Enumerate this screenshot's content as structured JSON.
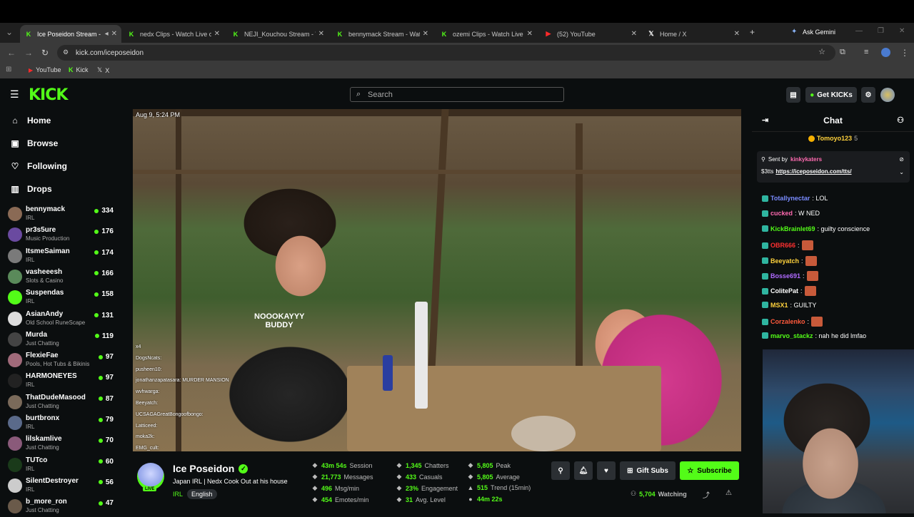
{
  "browser": {
    "tabs": [
      {
        "title": "Ice Poseidon Stream - V",
        "icon": "kick-icon",
        "active": true
      },
      {
        "title": "nedx Clips - Watch Live on",
        "icon": "kick-icon"
      },
      {
        "title": "NEJI_Kouchou Stream - Wa",
        "icon": "kick-icon"
      },
      {
        "title": "bennymack Stream - Watch",
        "icon": "kick-icon"
      },
      {
        "title": "ozemi Clips - Watch Live o",
        "icon": "kick-icon"
      },
      {
        "title": "(52) YouTube",
        "icon": "youtube-icon"
      },
      {
        "title": "Home / X",
        "icon": "x-icon"
      }
    ],
    "ask_gemini": "Ask Gemini",
    "url": "kick.com/iceposeidon",
    "bookmarks": [
      "YouTube",
      "Kick",
      "X"
    ]
  },
  "header": {
    "logo": "KICK",
    "search_placeholder": "Search",
    "get_kicks": "Get KICKs"
  },
  "sidebar": {
    "nav": [
      {
        "label": "Home",
        "icon": "home-icon"
      },
      {
        "label": "Browse",
        "icon": "browse-icon"
      },
      {
        "label": "Following",
        "icon": "heart-icon"
      },
      {
        "label": "Drops",
        "icon": "drops-icon"
      }
    ],
    "channels": [
      {
        "name": "bennymack",
        "category": "IRL",
        "viewers": "334",
        "color": "#8a6a55"
      },
      {
        "name": "pr3s5ure",
        "category": "Music Production",
        "viewers": "176",
        "color": "#6a4aa0"
      },
      {
        "name": "ItsmeSaiman",
        "category": "IRL",
        "viewers": "174",
        "color": "#7a7a7a"
      },
      {
        "name": "vasheeesh",
        "category": "Slots & Casino",
        "viewers": "166",
        "color": "#5a8a5a"
      },
      {
        "name": "Suspendas",
        "category": "IRL",
        "viewers": "158",
        "color": "#53fc18"
      },
      {
        "name": "AsianAndy",
        "category": "Old School RuneScape",
        "viewers": "131",
        "color": "#dddddd"
      },
      {
        "name": "Murda",
        "category": "Just Chatting",
        "viewers": "119",
        "color": "#444444"
      },
      {
        "name": "FlexieFae",
        "category": "Pools, Hot Tubs & Bikinis",
        "viewers": "97",
        "color": "#a06a7a"
      },
      {
        "name": "HARMONEYES",
        "category": "IRL",
        "viewers": "97",
        "color": "#222222"
      },
      {
        "name": "ThatDudeMasood",
        "category": "Just Chatting",
        "viewers": "87",
        "color": "#7a6a5a"
      },
      {
        "name": "burtbronx",
        "category": "IRL",
        "viewers": "79",
        "color": "#5a6a8a"
      },
      {
        "name": "lilskamlive",
        "category": "Just Chatting",
        "viewers": "70",
        "color": "#8a5a7a"
      },
      {
        "name": "TUTco",
        "category": "IRL",
        "viewers": "60",
        "color": "#1a3a1a"
      },
      {
        "name": "SilentDestroyer",
        "category": "IRL",
        "viewers": "56",
        "color": "#cccccc"
      },
      {
        "name": "b_more_ron",
        "category": "Just Chatting",
        "viewers": "47",
        "color": "#6a5a4a"
      }
    ]
  },
  "video": {
    "timestamp": "Aug 9, 5:24 PM",
    "shirt_text": "NOOOKAYYY BUDDY",
    "overlay_chat": [
      "x4",
      "DogsNcats:",
      "pusheen10:",
      "jonathanzapatasara: MURDER MANSION",
      "wvhwarga:",
      "Beeyatch:",
      "UCSAGAGreatBongoofbongo:",
      "Latticeed:",
      "moka2k:",
      "EMG_cult:"
    ]
  },
  "stream": {
    "name": "Ice Poseidon",
    "live_badge": "LIVE",
    "title": "Japan IRL | Nedx Cook Out at his house",
    "category": "IRL",
    "language": "English",
    "stats": [
      {
        "value": "43m 54s",
        "label": "Session",
        "icon": "clock-icon"
      },
      {
        "value": "21,773",
        "label": "Messages",
        "icon": "message-icon"
      },
      {
        "value": "496",
        "label": "Msg/min",
        "icon": "chart-icon"
      },
      {
        "value": "454",
        "label": "Emotes/min",
        "icon": "emote-icon"
      },
      {
        "value": "1,345",
        "label": "Chatters",
        "icon": "users-icon"
      },
      {
        "value": "433",
        "label": "Casuals",
        "icon": "users-icon"
      },
      {
        "value": "23%",
        "label": "Engagement",
        "icon": "engagement-icon"
      },
      {
        "value": "31",
        "label": "Avg. Level",
        "icon": "trophy-icon"
      },
      {
        "value": "5,805",
        "label": "Peak",
        "icon": "peak-icon"
      },
      {
        "value": "5,805",
        "label": "Average",
        "icon": "average-icon"
      },
      {
        "value": "515",
        "label": "Trend (15min)",
        "icon": "trend-up-icon"
      },
      {
        "value": "44m 22s",
        "label": "",
        "icon": "dot-icon"
      }
    ],
    "gift_subs": "Gift Subs",
    "subscribe": "Subscribe",
    "watching_count": "5,704",
    "watching_label": "Watching"
  },
  "chat": {
    "title": "Chat",
    "top_gifter": {
      "name": "Tomoyo123",
      "count": "5"
    },
    "pinned": {
      "sent_by_label": "Sent by",
      "sender": "kinkykaters",
      "text_prefix": "$3tts",
      "link": "https://iceposeidon.com/tts/"
    },
    "messages": [
      {
        "user": "Totallynectar",
        "text": ": LOL",
        "color": "#7a8cff"
      },
      {
        "user": "cucked",
        "text": ": W NED",
        "color": "#ff6ab0"
      },
      {
        "user": "KickBrainlet69",
        "text": ": guilty conscience",
        "color": "#53fc18"
      },
      {
        "user": "OBR666",
        "text": ":",
        "color": "#ff3030"
      },
      {
        "user": "Beeyatch",
        "text": ":",
        "color": "#ffd23c"
      },
      {
        "user": "Bosse691",
        "text": ":",
        "color": "#b06aff"
      },
      {
        "user": "ColitePat",
        "text": ":",
        "color": "#ffffff"
      },
      {
        "user": "MSX1",
        "text": ": GUILTY",
        "color": "#ffd23c"
      },
      {
        "user": "Corzalenko",
        "text": ":",
        "color": "#ff5a3c"
      },
      {
        "user": "marvo_stackz",
        "text": ": nah he did lmfao",
        "color": "#53fc18"
      }
    ]
  }
}
